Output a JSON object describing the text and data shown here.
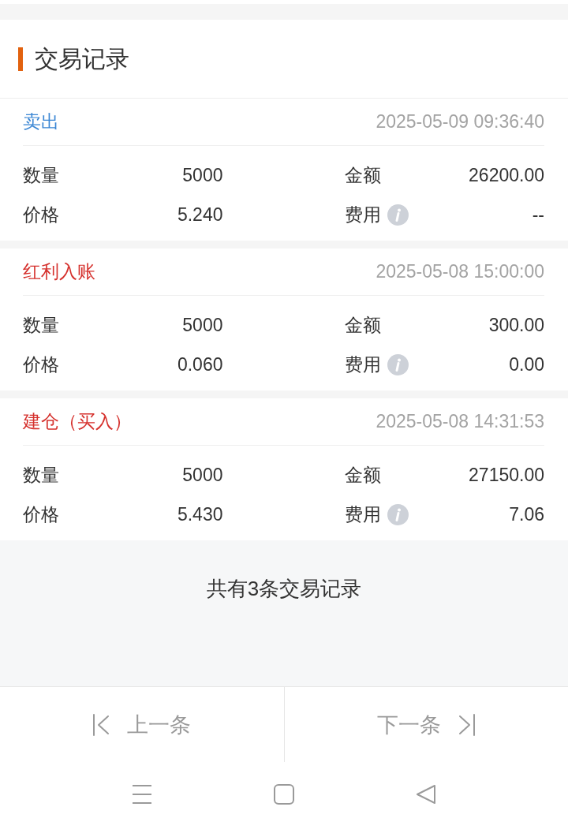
{
  "page_title": "交易记录",
  "records": [
    {
      "type": "卖出",
      "color": "#3a86d4",
      "time": "2025-05-09 09:36:40",
      "fields": [
        {
          "label": "数量",
          "value": "5000"
        },
        {
          "label": "金额",
          "value": "26200.00"
        },
        {
          "label": "价格",
          "value": "5.240"
        },
        {
          "label": "费用",
          "value": "--",
          "info_icon": true
        }
      ]
    },
    {
      "type": "红利入账",
      "color": "#d5302c",
      "time": "2025-05-08 15:00:00",
      "fields": [
        {
          "label": "数量",
          "value": "5000"
        },
        {
          "label": "金额",
          "value": "300.00"
        },
        {
          "label": "价格",
          "value": "0.060"
        },
        {
          "label": "费用",
          "value": "0.00",
          "info_icon": true
        }
      ]
    },
    {
      "type": "建仓（买入）",
      "color": "#d5302c",
      "time": "2025-05-08 14:31:53",
      "fields": [
        {
          "label": "数量",
          "value": "5000"
        },
        {
          "label": "金额",
          "value": "27150.00"
        },
        {
          "label": "价格",
          "value": "5.430"
        },
        {
          "label": "费用",
          "value": "7.06",
          "info_icon": true
        }
      ]
    }
  ],
  "summary": "共有3条交易记录",
  "pager": [
    {
      "kind": "previous",
      "label": "上一条"
    },
    {
      "kind": "next",
      "label": "下一条"
    }
  ]
}
